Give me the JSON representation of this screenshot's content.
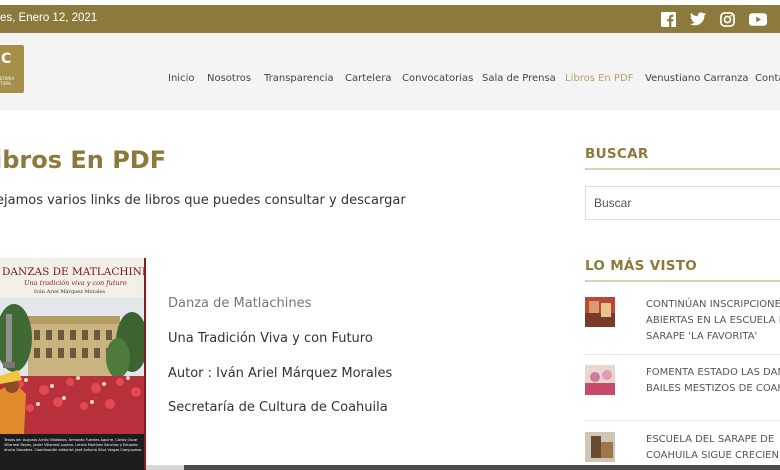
{
  "topbar": {
    "date": "es, Enero 12, 2021",
    "background": "#8c7a3c",
    "social_icons": [
      "facebook-icon",
      "twitter-icon",
      "instagram-icon",
      "youtube-icon"
    ]
  },
  "header": {
    "logo_letters": "C",
    "logo_small": "ETARIA\nTURA",
    "nav": [
      "Inicio",
      "Nosotros",
      "Transparencia",
      "Cartelera",
      "Convocatorias",
      "Sala de Prensa",
      "Libros En PDF",
      "Venustiano Carranza",
      "Conta"
    ],
    "active_nav": "Libros En PDF",
    "accent": "#b4a366"
  },
  "main": {
    "title": "ibros En PDF",
    "intro": "ejamos varios links de libros que puedes consultar y descargar",
    "book": {
      "cover_title": "DANZAS DE MATLACHINES",
      "cover_subtitle": "Una tradición viva y con futuro",
      "cover_author": "Iván Ariel Márquez Morales",
      "cover_credits": "Textos de: Augusto Arrillo Villalobos, Armando Fuentes Aguirre, Carlos Oscar Villarreal Reyes, Javier Villarreal Lozano, Leticia Martínez Sánchez y Eduardo Ancira Gonzalez. Coordinación editorial: José Antonio Silva Vargas Campuzano.",
      "lines": [
        "Danza de Matlachines",
        "Una Tradición Viva y con Futuro",
        "Autor : Iván Ariel Márquez Morales",
        "Secretaría de Cultura de Coahuila"
      ]
    }
  },
  "sidebar": {
    "search_heading": "BUSCAR",
    "search_placeholder": "Buscar",
    "most_viewed_heading": "LO MÁS VISTO",
    "news": [
      {
        "lines": [
          "CONTINÚAN INSCRIPCIONES",
          "ABIERTAS EN LA ESCUELA D",
          "SARAPE 'LA FAVORITA'"
        ]
      },
      {
        "lines": [
          "FOMENTA ESTADO LAS DAN",
          "BAILES MESTIZOS DE COAH"
        ]
      },
      {
        "lines": [
          "ESCUELA DEL SARAPE DE",
          "COAHUILA SIGUE CRECIEND"
        ]
      }
    ]
  }
}
